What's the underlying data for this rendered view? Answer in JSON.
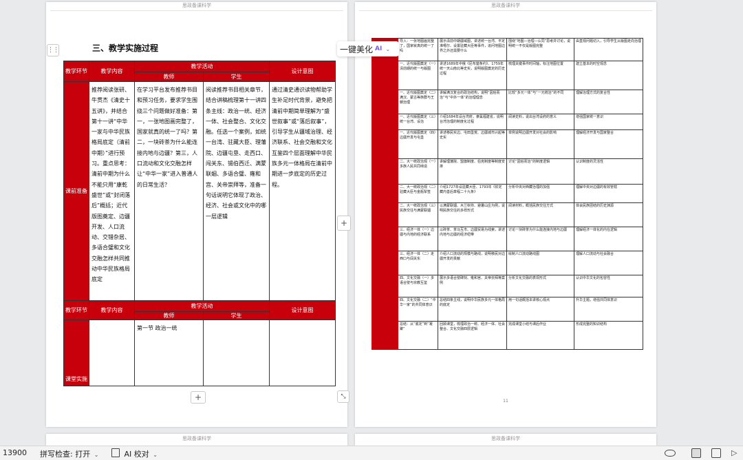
{
  "header": {
    "text": "思政备课科学"
  },
  "left_page": {
    "section_title": "三、教学实施过程",
    "col_stage": "教学环节",
    "col_content": "教学内容",
    "col_activity": "教学活动",
    "col_teacher": "教师",
    "col_student": "学生",
    "col_intent": "设计意图",
    "row1": {
      "stage": "课前准备",
      "content": "推荐阅读张研、牛贯杰《清史十五讲》，并结合第十一讲“中华一家与中华民族格局底定（清前中期）”进行预习。重点思考：清前中期为什么不能只用“康乾盛世”或“封闭落后”概括；近代版图奠定、边疆开发、人口流动、交错杂居、多语合璧和文化交融怎样共同推动中华民族格局底定",
      "teacher": "在学习平台发布推荐书目和预习任务，要求学生围绕三个问题做好准备：第一，一张地图画完整了，国家就真的统一了吗？第二，一块砖茶为什么能连接内地与边疆？第三，人口流动和文化交融怎样让“中华一家”进入普通人的日常生活？",
      "student": "阅读推荐书目相关章节，结合讲稿梳理第十一讲四条主线：政治一统、经济一体、社会整合、文化交融。任选一个案例，如统一台湾、驻藏大臣、理藩院、边疆屯垦、走西口、闯关东、锡伯西迁、满蒙联姻、多语合璧、雍和宫、关帝崇拜等，准备一句话说明它体现了政治、经济、社会或文化中的哪一层逻辑",
      "intent": "通过清史通识读物帮助学生补足时代背景，避免把清前中期简单理解为“盛世叙事”或“落后叙事”，引导学生从疆域治理、经济联系、社会交融和文化互鉴四个层面理解中华民族多元一体格局在清前中期进一步底定的历史过程。"
    },
    "row2": {
      "stage": "课堂实施",
      "teacher": "第一节 政治一统"
    }
  },
  "right_page": {
    "rows": [
      [
        "导入：一张地图画完整了，国家就真的统一了吗",
        "展示清前中期疆域图，讲述统一台湾、平定准噶尔、设置驻藏大臣等事件，追问地图边界之外还需要什么",
        "围绕“地图—治理—认同”思考并讨论，说明统一不仅是版图完整",
        "由直观问题切入，引导学生从版图走向治理"
      ],
      [
        "一、近代版图奠定（一）清前期的统一与版图",
        "讲述1689年中俄《尼布楚条约》、1759年统一天山南北等史实，说明版图奠定的历史过程",
        "梳理关键事件时间轴，标注地图位置",
        "建立基本的时空观念"
      ],
      [
        "一、近代版图奠定（二）满汉、蒙古等族群与王朝治理",
        "讲解满汉复合的政治结构，说明“因俗而治”与“中外一体”的治理理念",
        "比较“多元一体”与“一元统治”的不同",
        "理解治理方式的复合性"
      ],
      [
        "一、近代版图奠定（三）统一台湾、设治",
        "介绍1684年设台湾府，隶属福建省，说明台湾治理的制度化过程",
        "阅读史料，说出台湾设府的意义",
        "增强国家统一意识"
      ],
      [
        "一、近代版图奠定（四）边疆开发与屯垦",
        "讲述移民实边、屯田垦荒、边疆城市兴起等史实",
        "举例说明边疆开发对社会的影响",
        "理解经济开发与国家整合"
      ],
      [
        "二、大一统政治观（一）多族人民共同缔造",
        "讲解理藩院、盟旗制度、伯克制度等制度安排",
        "讨论“因俗而治”的制度逻辑",
        "认识制度的灵活性"
      ],
      [
        "二、大一统政治观（二）驻藏大臣与金瓶掣签",
        "介绍1727年设驻藏大臣、1793年《钦定藏内善后章程二十九条》",
        "分析中央对西藏治理的加强",
        "理解中央对边疆的有效管辖"
      ],
      [
        "二、大一统政治观（三）民族交往与满蒙联姻",
        "以满蒙联姻、木兰秋狝、避暑山庄为例，说明民族交往的多样形式",
        "阅读材料，概括民族交往方式",
        "体会民族团结的历史渊源"
      ],
      [
        "三、经济一体（一）边疆与内地的经济联系",
        "以砖茶、茶马互市、边疆贸易为线索，讲述内地与边疆的经济纽带",
        "讨论一块砖茶为什么能连接内地与边疆",
        "理解经济一体化的内在逻辑"
      ],
      [
        "三、经济一体（二）走西口与闯关东",
        "介绍人口流动的规模与路线，说明移民对边疆开发的贡献",
        "绘制人口流动路线图",
        "理解人口流动与社会融合"
      ],
      [
        "四、文化交融（一）多语合璧与宗教互鉴",
        "展示多语合璧碑刻、雍和宫、关帝崇拜等案例",
        "分析文化交融的表现形式",
        "认识中华文化的包容性"
      ],
      [
        "四、文化交融（二）“中华一家”的共同体意识",
        "总结四条主线，说明中华民族多元一体格局的底定",
        "用一句话概括本讲核心观点",
        "升华主题，增强共同体意识"
      ],
      [
        "总结：从“底定”到“凝聚”",
        "回顾课堂，梳理政治一统、经济一体、社会整合、文化交融四层逻辑",
        "完成课堂小结与课后作业",
        "形成完整的知识结构"
      ]
    ]
  },
  "float_bar": {
    "label": "一键美化",
    "badge": "AI"
  },
  "page_number": "11",
  "status_bar": {
    "word_count": "13900",
    "spell_check": "拼写检查: 打开",
    "ai_check": "AI 校对"
  }
}
